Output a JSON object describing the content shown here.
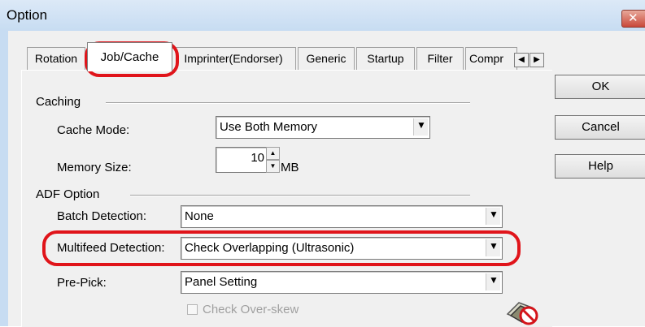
{
  "window": {
    "title": "Option",
    "close_glyph": "✕"
  },
  "tabs": [
    {
      "label": "Rotation",
      "active": false
    },
    {
      "label": "Job/Cache",
      "active": true
    },
    {
      "label": "Imprinter(Endorser)",
      "active": false
    },
    {
      "label": "Generic",
      "active": false
    },
    {
      "label": "Startup",
      "active": false
    },
    {
      "label": "Filter",
      "active": false
    },
    {
      "label": "Compr",
      "active": false
    }
  ],
  "tab_scroll": {
    "left_glyph": "◀",
    "right_glyph": "▶"
  },
  "buttons": {
    "ok": "OK",
    "cancel": "Cancel",
    "help": "Help"
  },
  "caching": {
    "group_label": "Caching",
    "cache_mode_label": "Cache Mode:",
    "cache_mode_value": "Use Both Memory",
    "memory_size_label": "Memory Size:",
    "memory_size_value": "10",
    "memory_size_unit": "MB"
  },
  "adf": {
    "group_label": "ADF Option",
    "batch_detection_label": "Batch Detection:",
    "batch_detection_value": "None",
    "multifeed_detection_label": "Multifeed Detection:",
    "multifeed_detection_value": "Check Overlapping (Ultrasonic)",
    "pre_pick_label": "Pre-Pick:",
    "pre_pick_value": "Panel Setting",
    "check_overskew_label": "Check Over-skew",
    "check_overskew_checked": false,
    "check_overskew_enabled": false
  },
  "dropdown_glyph": "▼",
  "spin_up_glyph": "▲",
  "spin_down_glyph": "▼",
  "highlight_color": "#e0141a"
}
